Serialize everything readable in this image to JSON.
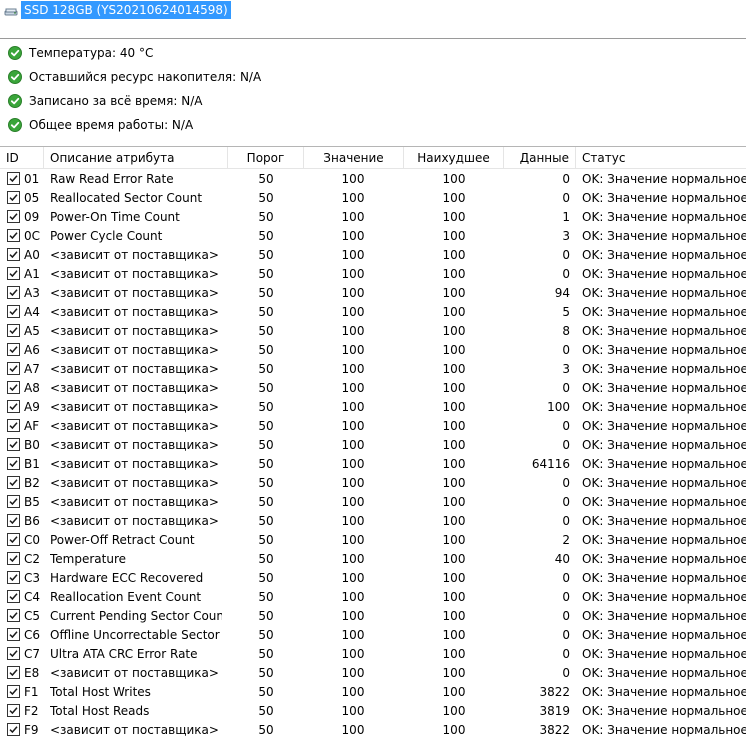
{
  "drive": {
    "label": "SSD 128GB (YS20210624014598)"
  },
  "summary": [
    {
      "label": "Температура: 40 °C"
    },
    {
      "label": "Оставшийся ресурс накопителя: N/A"
    },
    {
      "label": "Записано за всё время: N/A"
    },
    {
      "label": "Общее время работы: N/A"
    }
  ],
  "table": {
    "columns": [
      "ID",
      "Описание атрибута",
      "Порог",
      "Значение",
      "Наихудшее",
      "Данные",
      "Статус"
    ],
    "rows": [
      {
        "id": "01",
        "desc": "Raw Read Error Rate",
        "thr": "50",
        "val": "100",
        "worst": "100",
        "data": "0",
        "status": "OK: Значение нормальное"
      },
      {
        "id": "05",
        "desc": "Reallocated Sector Count",
        "thr": "50",
        "val": "100",
        "worst": "100",
        "data": "0",
        "status": "OK: Значение нормальное"
      },
      {
        "id": "09",
        "desc": "Power-On Time Count",
        "thr": "50",
        "val": "100",
        "worst": "100",
        "data": "1",
        "status": "OK: Значение нормальное"
      },
      {
        "id": "0C",
        "desc": "Power Cycle Count",
        "thr": "50",
        "val": "100",
        "worst": "100",
        "data": "3",
        "status": "OK: Значение нормальное"
      },
      {
        "id": "A0",
        "desc": "<зависит от поставщика>",
        "thr": "50",
        "val": "100",
        "worst": "100",
        "data": "0",
        "status": "OK: Значение нормальное"
      },
      {
        "id": "A1",
        "desc": "<зависит от поставщика>",
        "thr": "50",
        "val": "100",
        "worst": "100",
        "data": "0",
        "status": "OK: Значение нормальное"
      },
      {
        "id": "A3",
        "desc": "<зависит от поставщика>",
        "thr": "50",
        "val": "100",
        "worst": "100",
        "data": "94",
        "status": "OK: Значение нормальное"
      },
      {
        "id": "A4",
        "desc": "<зависит от поставщика>",
        "thr": "50",
        "val": "100",
        "worst": "100",
        "data": "5",
        "status": "OK: Значение нормальное"
      },
      {
        "id": "A5",
        "desc": "<зависит от поставщика>",
        "thr": "50",
        "val": "100",
        "worst": "100",
        "data": "8",
        "status": "OK: Значение нормальное"
      },
      {
        "id": "A6",
        "desc": "<зависит от поставщика>",
        "thr": "50",
        "val": "100",
        "worst": "100",
        "data": "0",
        "status": "OK: Значение нормальное"
      },
      {
        "id": "A7",
        "desc": "<зависит от поставщика>",
        "thr": "50",
        "val": "100",
        "worst": "100",
        "data": "3",
        "status": "OK: Значение нормальное"
      },
      {
        "id": "A8",
        "desc": "<зависит от поставщика>",
        "thr": "50",
        "val": "100",
        "worst": "100",
        "data": "0",
        "status": "OK: Значение нормальное"
      },
      {
        "id": "A9",
        "desc": "<зависит от поставщика>",
        "thr": "50",
        "val": "100",
        "worst": "100",
        "data": "100",
        "status": "OK: Значение нормальное"
      },
      {
        "id": "AF",
        "desc": "<зависит от поставщика>",
        "thr": "50",
        "val": "100",
        "worst": "100",
        "data": "0",
        "status": "OK: Значение нормальное"
      },
      {
        "id": "B0",
        "desc": "<зависит от поставщика>",
        "thr": "50",
        "val": "100",
        "worst": "100",
        "data": "0",
        "status": "OK: Значение нормальное"
      },
      {
        "id": "B1",
        "desc": "<зависит от поставщика>",
        "thr": "50",
        "val": "100",
        "worst": "100",
        "data": "64116",
        "status": "OK: Значение нормальное"
      },
      {
        "id": "B2",
        "desc": "<зависит от поставщика>",
        "thr": "50",
        "val": "100",
        "worst": "100",
        "data": "0",
        "status": "OK: Значение нормальное"
      },
      {
        "id": "B5",
        "desc": "<зависит от поставщика>",
        "thr": "50",
        "val": "100",
        "worst": "100",
        "data": "0",
        "status": "OK: Значение нормальное"
      },
      {
        "id": "B6",
        "desc": "<зависит от поставщика>",
        "thr": "50",
        "val": "100",
        "worst": "100",
        "data": "0",
        "status": "OK: Значение нормальное"
      },
      {
        "id": "C0",
        "desc": "Power-Off Retract Count",
        "thr": "50",
        "val": "100",
        "worst": "100",
        "data": "2",
        "status": "OK: Значение нормальное"
      },
      {
        "id": "C2",
        "desc": "Temperature",
        "thr": "50",
        "val": "100",
        "worst": "100",
        "data": "40",
        "status": "OK: Значение нормальное"
      },
      {
        "id": "C3",
        "desc": "Hardware ECC Recovered",
        "thr": "50",
        "val": "100",
        "worst": "100",
        "data": "0",
        "status": "OK: Значение нормальное"
      },
      {
        "id": "C4",
        "desc": "Reallocation Event Count",
        "thr": "50",
        "val": "100",
        "worst": "100",
        "data": "0",
        "status": "OK: Значение нормальное"
      },
      {
        "id": "C5",
        "desc": "Current Pending Sector Count",
        "thr": "50",
        "val": "100",
        "worst": "100",
        "data": "0",
        "status": "OK: Значение нормальное"
      },
      {
        "id": "C6",
        "desc": "Offline Uncorrectable Sector C...",
        "thr": "50",
        "val": "100",
        "worst": "100",
        "data": "0",
        "status": "OK: Значение нормальное"
      },
      {
        "id": "C7",
        "desc": "Ultra ATA CRC Error Rate",
        "thr": "50",
        "val": "100",
        "worst": "100",
        "data": "0",
        "status": "OK: Значение нормальное"
      },
      {
        "id": "E8",
        "desc": "<зависит от поставщика>",
        "thr": "50",
        "val": "100",
        "worst": "100",
        "data": "0",
        "status": "OK: Значение нормальное"
      },
      {
        "id": "F1",
        "desc": "Total Host Writes",
        "thr": "50",
        "val": "100",
        "worst": "100",
        "data": "3822",
        "status": "OK: Значение нормальное"
      },
      {
        "id": "F2",
        "desc": "Total Host Reads",
        "thr": "50",
        "val": "100",
        "worst": "100",
        "data": "3819",
        "status": "OK: Значение нормальное"
      },
      {
        "id": "F9",
        "desc": "<зависит от поставщика>",
        "thr": "50",
        "val": "100",
        "worst": "100",
        "data": "3822",
        "status": "OK: Значение нормальное"
      }
    ]
  },
  "colors": {
    "selection": "#3399ff",
    "ok_green": "#3aa53a"
  },
  "icons": {
    "drive": "drive-icon",
    "status": "ok-check-icon",
    "row": "checkbox-checked-icon"
  }
}
